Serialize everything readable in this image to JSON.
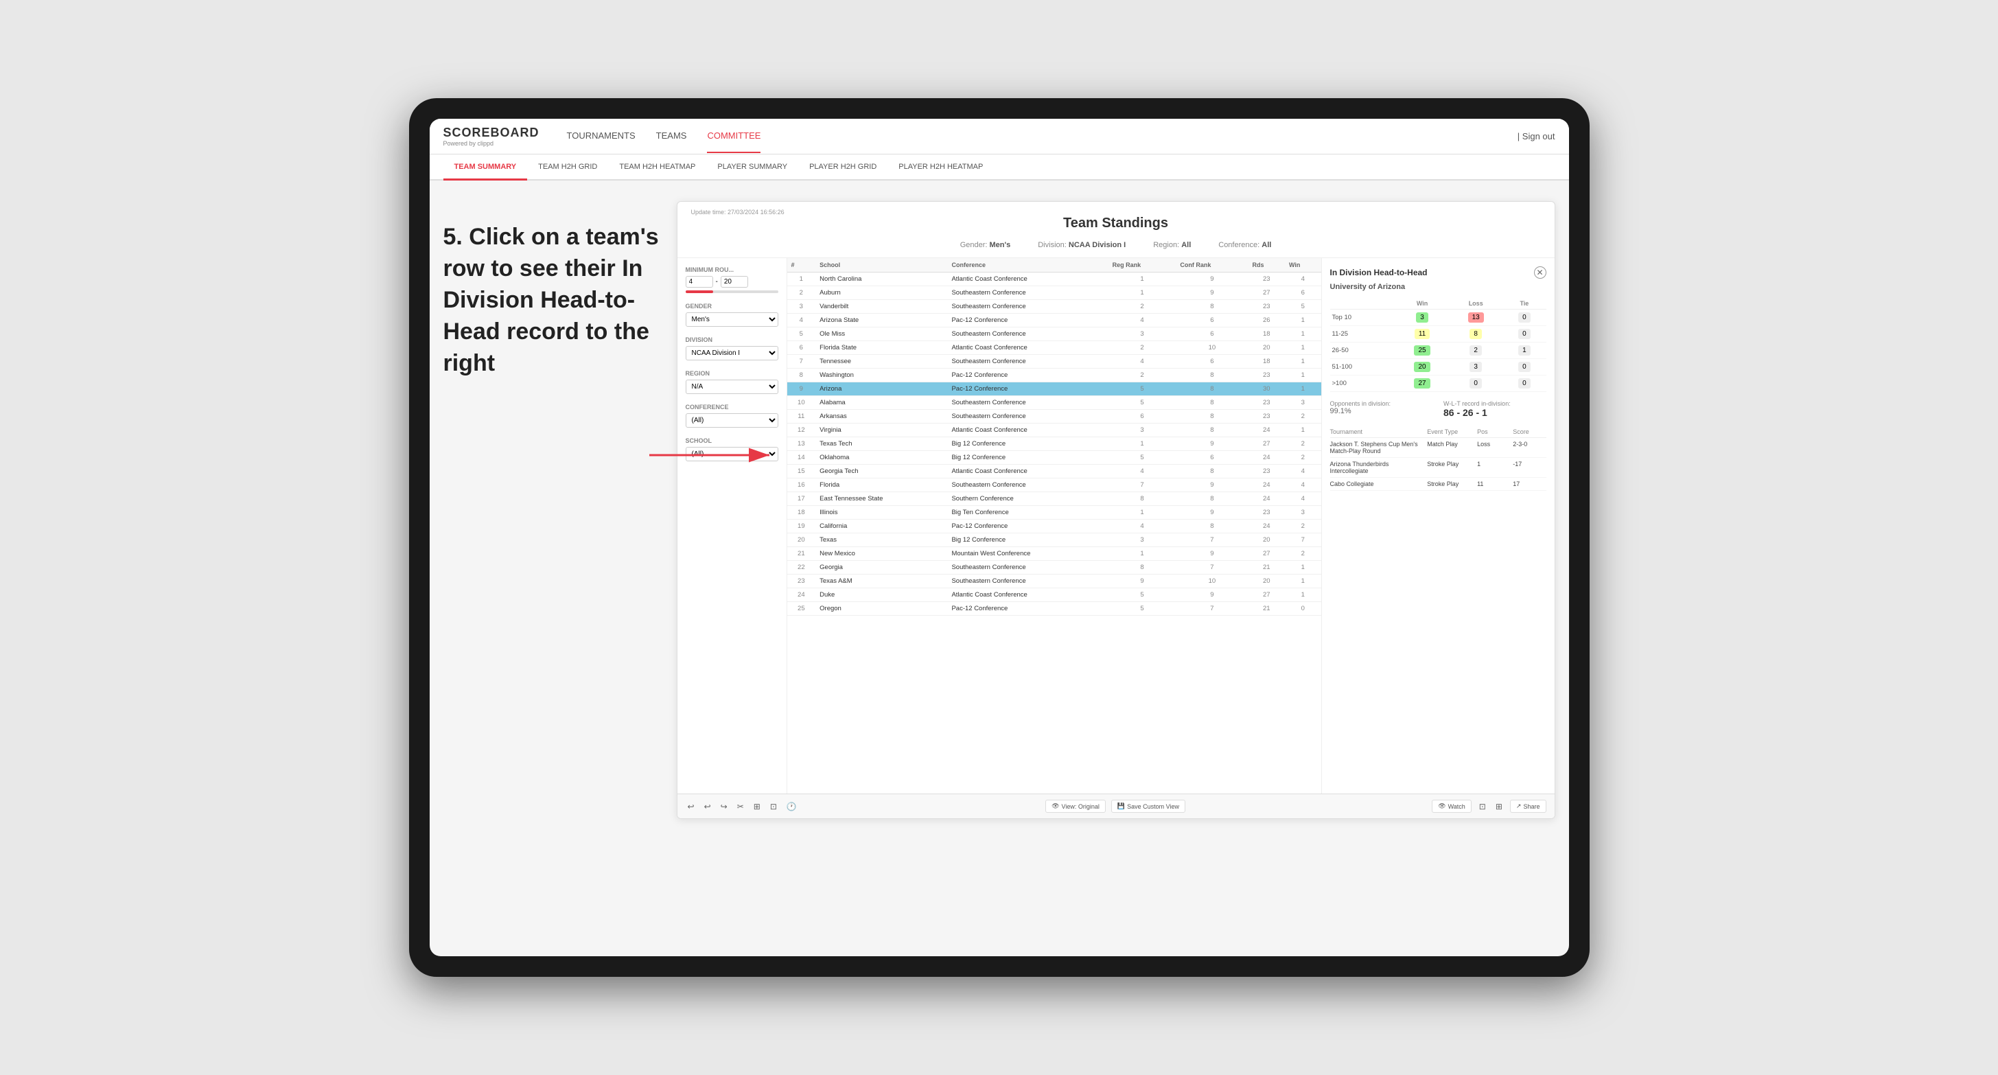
{
  "app": {
    "logo": "SCOREBOARD",
    "logo_sub": "Powered by clippd",
    "sign_out": "| Sign out"
  },
  "top_nav": {
    "items": [
      {
        "label": "TOURNAMENTS",
        "active": false
      },
      {
        "label": "TEAMS",
        "active": false
      },
      {
        "label": "COMMITTEE",
        "active": true
      }
    ]
  },
  "sub_nav": {
    "items": [
      {
        "label": "TEAM SUMMARY",
        "active": true
      },
      {
        "label": "TEAM H2H GRID",
        "active": false
      },
      {
        "label": "TEAM H2H HEATMAP",
        "active": false
      },
      {
        "label": "PLAYER SUMMARY",
        "active": false
      },
      {
        "label": "PLAYER H2H GRID",
        "active": false
      },
      {
        "label": "PLAYER H2H HEATMAP",
        "active": false
      }
    ]
  },
  "annotation": {
    "text": "5. Click on a team's row to see their In Division Head-to-Head record to the right"
  },
  "panel": {
    "update_time": "Update time:",
    "update_value": "27/03/2024 16:56:26",
    "title": "Team Standings",
    "filters": {
      "gender": {
        "label": "Gender:",
        "value": "Men's"
      },
      "division": {
        "label": "Division:",
        "value": "NCAA Division I"
      },
      "region": {
        "label": "Region:",
        "value": "All"
      },
      "conference": {
        "label": "Conference:",
        "value": "All"
      }
    }
  },
  "filter_sidebar": {
    "minimum_rounds": {
      "label": "Minimum Rou...",
      "min": "4",
      "max": "20"
    },
    "gender": {
      "label": "Gender",
      "value": "Men's"
    },
    "division": {
      "label": "Division",
      "value": "NCAA Division I"
    },
    "region": {
      "label": "Region",
      "value": "N/A"
    },
    "conference": {
      "label": "Conference",
      "value": "(All)"
    },
    "school": {
      "label": "School",
      "value": "(All)"
    }
  },
  "table": {
    "headers": [
      "#",
      "School",
      "Conference",
      "Reg Rank",
      "Conf Rank",
      "Rds",
      "Win"
    ],
    "rows": [
      {
        "rank": 1,
        "school": "North Carolina",
        "conference": "Atlantic Coast Conference",
        "reg_rank": 1,
        "conf_rank": 9,
        "rds": 23,
        "win": 4,
        "selected": false
      },
      {
        "rank": 2,
        "school": "Auburn",
        "conference": "Southeastern Conference",
        "reg_rank": 1,
        "conf_rank": 9,
        "rds": 27,
        "win": 6,
        "selected": false
      },
      {
        "rank": 3,
        "school": "Vanderbilt",
        "conference": "Southeastern Conference",
        "reg_rank": 2,
        "conf_rank": 8,
        "rds": 23,
        "win": 5,
        "selected": false
      },
      {
        "rank": 4,
        "school": "Arizona State",
        "conference": "Pac-12 Conference",
        "reg_rank": 4,
        "conf_rank": 6,
        "rds": 26,
        "win": 1,
        "selected": false
      },
      {
        "rank": 5,
        "school": "Ole Miss",
        "conference": "Southeastern Conference",
        "reg_rank": 3,
        "conf_rank": 6,
        "rds": 18,
        "win": 1,
        "selected": false
      },
      {
        "rank": 6,
        "school": "Florida State",
        "conference": "Atlantic Coast Conference",
        "reg_rank": 2,
        "conf_rank": 10,
        "rds": 20,
        "win": 1,
        "selected": false
      },
      {
        "rank": 7,
        "school": "Tennessee",
        "conference": "Southeastern Conference",
        "reg_rank": 4,
        "conf_rank": 6,
        "rds": 18,
        "win": 1,
        "selected": false
      },
      {
        "rank": 8,
        "school": "Washington",
        "conference": "Pac-12 Conference",
        "reg_rank": 2,
        "conf_rank": 8,
        "rds": 23,
        "win": 1,
        "selected": false
      },
      {
        "rank": 9,
        "school": "Arizona",
        "conference": "Pac-12 Conference",
        "reg_rank": 5,
        "conf_rank": 8,
        "rds": 30,
        "win": 1,
        "selected": true
      },
      {
        "rank": 10,
        "school": "Alabama",
        "conference": "Southeastern Conference",
        "reg_rank": 5,
        "conf_rank": 8,
        "rds": 23,
        "win": 3,
        "selected": false
      },
      {
        "rank": 11,
        "school": "Arkansas",
        "conference": "Southeastern Conference",
        "reg_rank": 6,
        "conf_rank": 8,
        "rds": 23,
        "win": 2,
        "selected": false
      },
      {
        "rank": 12,
        "school": "Virginia",
        "conference": "Atlantic Coast Conference",
        "reg_rank": 3,
        "conf_rank": 8,
        "rds": 24,
        "win": 1,
        "selected": false
      },
      {
        "rank": 13,
        "school": "Texas Tech",
        "conference": "Big 12 Conference",
        "reg_rank": 1,
        "conf_rank": 9,
        "rds": 27,
        "win": 2,
        "selected": false
      },
      {
        "rank": 14,
        "school": "Oklahoma",
        "conference": "Big 12 Conference",
        "reg_rank": 5,
        "conf_rank": 6,
        "rds": 24,
        "win": 2,
        "selected": false
      },
      {
        "rank": 15,
        "school": "Georgia Tech",
        "conference": "Atlantic Coast Conference",
        "reg_rank": 4,
        "conf_rank": 8,
        "rds": 23,
        "win": 4,
        "selected": false
      },
      {
        "rank": 16,
        "school": "Florida",
        "conference": "Southeastern Conference",
        "reg_rank": 7,
        "conf_rank": 9,
        "rds": 24,
        "win": 4,
        "selected": false
      },
      {
        "rank": 17,
        "school": "East Tennessee State",
        "conference": "Southern Conference",
        "reg_rank": 8,
        "conf_rank": 8,
        "rds": 24,
        "win": 4,
        "selected": false
      },
      {
        "rank": 18,
        "school": "Illinois",
        "conference": "Big Ten Conference",
        "reg_rank": 1,
        "conf_rank": 9,
        "rds": 23,
        "win": 3,
        "selected": false
      },
      {
        "rank": 19,
        "school": "California",
        "conference": "Pac-12 Conference",
        "reg_rank": 4,
        "conf_rank": 8,
        "rds": 24,
        "win": 2,
        "selected": false
      },
      {
        "rank": 20,
        "school": "Texas",
        "conference": "Big 12 Conference",
        "reg_rank": 3,
        "conf_rank": 7,
        "rds": 20,
        "win": 7,
        "selected": false
      },
      {
        "rank": 21,
        "school": "New Mexico",
        "conference": "Mountain West Conference",
        "reg_rank": 1,
        "conf_rank": 9,
        "rds": 27,
        "win": 2,
        "selected": false
      },
      {
        "rank": 22,
        "school": "Georgia",
        "conference": "Southeastern Conference",
        "reg_rank": 8,
        "conf_rank": 7,
        "rds": 21,
        "win": 1,
        "selected": false
      },
      {
        "rank": 23,
        "school": "Texas A&M",
        "conference": "Southeastern Conference",
        "reg_rank": 9,
        "conf_rank": 10,
        "rds": 20,
        "win": 1,
        "selected": false
      },
      {
        "rank": 24,
        "school": "Duke",
        "conference": "Atlantic Coast Conference",
        "reg_rank": 5,
        "conf_rank": 9,
        "rds": 27,
        "win": 1,
        "selected": false
      },
      {
        "rank": 25,
        "school": "Oregon",
        "conference": "Pac-12 Conference",
        "reg_rank": 5,
        "conf_rank": 7,
        "rds": 21,
        "win": 0,
        "selected": false
      }
    ]
  },
  "h2h": {
    "title": "In Division Head-to-Head",
    "team": "University of Arizona",
    "table_headers": [
      "",
      "Win",
      "Loss",
      "Tie"
    ],
    "rows": [
      {
        "rank": "Top 10",
        "win": 3,
        "loss": 13,
        "tie": 0,
        "win_color": "green",
        "loss_color": "red"
      },
      {
        "rank": "11-25",
        "win": 11,
        "loss": 8,
        "tie": 0,
        "win_color": "yellow",
        "loss_color": "yellow"
      },
      {
        "rank": "26-50",
        "win": 25,
        "loss": 2,
        "tie": 1,
        "win_color": "green",
        "loss_color": "gray"
      },
      {
        "rank": "51-100",
        "win": 20,
        "loss": 3,
        "tie": 0,
        "win_color": "green",
        "loss_color": "gray"
      },
      {
        "rank": ">100",
        "win": 27,
        "loss": 0,
        "tie": 0,
        "win_color": "green",
        "loss_color": "gray"
      }
    ],
    "opponents_label": "Opponents in division:",
    "opponents_value": "99.1%",
    "record_label": "W-L-T record in-division:",
    "record_value": "86 - 26 - 1",
    "tournaments": {
      "header": [
        "Tournament",
        "Event Type",
        "Pos",
        "Score"
      ],
      "rows": [
        {
          "tournament": "Jackson T. Stephens Cup Men's Match-Play Round",
          "event_type": "Match Play",
          "pos": "Loss",
          "score": "2-3-0"
        },
        {
          "tournament": "Arizona Thunderbirds Intercollegiate",
          "event_type": "Stroke Play",
          "pos": "1",
          "score": "-17"
        },
        {
          "tournament": "Cabo Collegiate",
          "event_type": "Stroke Play",
          "pos": "11",
          "score": "17"
        }
      ]
    }
  },
  "toolbar": {
    "undo": "↩",
    "redo": "↪",
    "view_original": "View: Original",
    "save_custom": "Save Custom View",
    "watch": "Watch",
    "share": "Share"
  }
}
